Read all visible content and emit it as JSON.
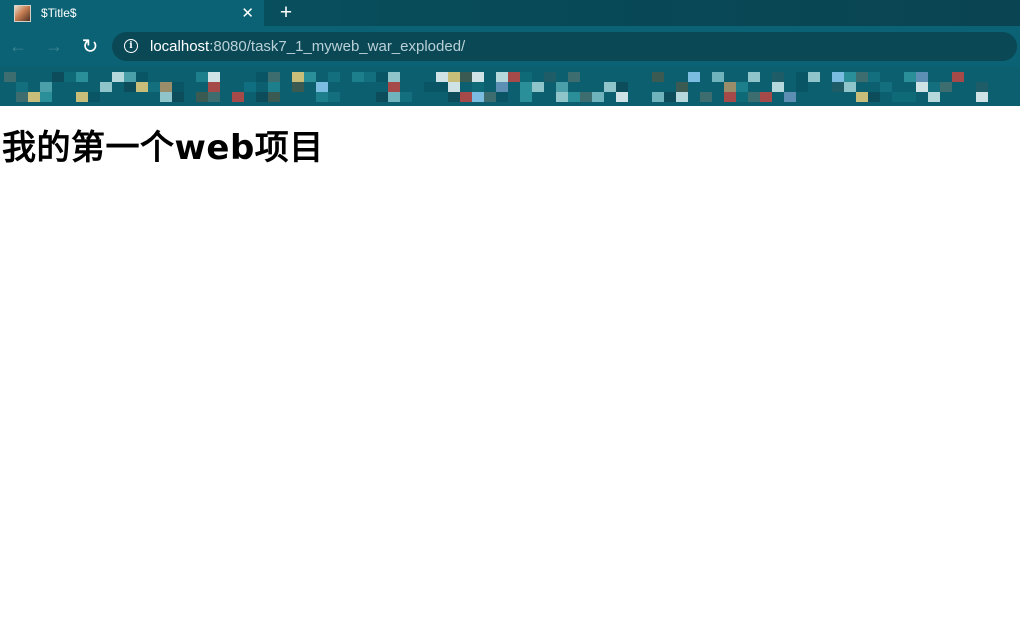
{
  "tab": {
    "title": "$Title$",
    "close_glyph": "✕"
  },
  "new_tab_glyph": "+",
  "nav": {
    "back_glyph": "←",
    "forward_glyph": "→",
    "reload_glyph": "↻"
  },
  "address": {
    "info_glyph": "i",
    "host": "localhost",
    "rest": ":8080/task7_1_myweb_war_exploded/"
  },
  "page": {
    "heading": "我的第一个web项目"
  },
  "colors": {
    "tab_strip": "#07505f",
    "toolbar": "#0b6274",
    "address_bg": "#0a4856",
    "bookmarks_bar": "#0c5f6f"
  },
  "icons": {
    "favicon": "tab-favicon",
    "close": "close-icon",
    "new_tab": "plus-icon",
    "back": "back-arrow-icon",
    "forward": "forward-arrow-icon",
    "reload": "reload-icon",
    "info": "info-icon"
  }
}
